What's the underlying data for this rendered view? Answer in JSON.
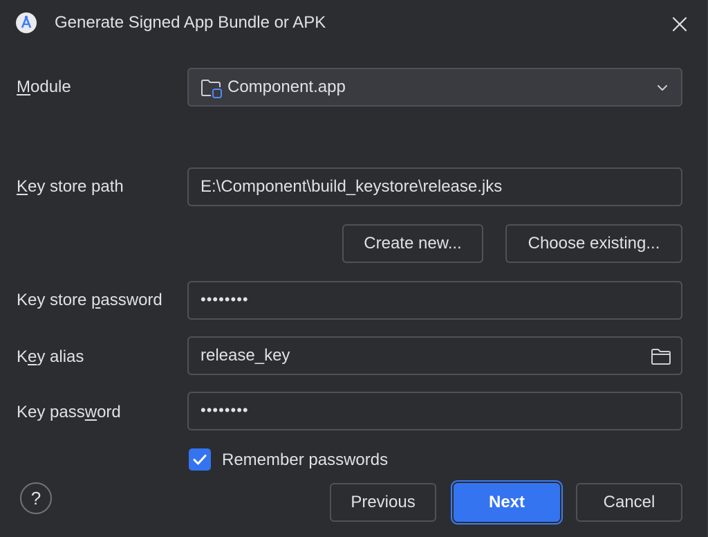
{
  "dialog": {
    "title": "Generate Signed App Bundle or APK",
    "app_icon": "android-studio-icon",
    "close_icon": "close-icon"
  },
  "module": {
    "label_mnemonic": "M",
    "label_rest": "odule",
    "selected": "Component.app",
    "icon": "module-folder-icon",
    "dropdown_icon": "chevron-down-icon"
  },
  "key_store_path": {
    "label_mnemonic": "K",
    "label_rest": "ey store path",
    "value": "E:\\Component\\build_keystore\\release.jks"
  },
  "key_store_buttons": {
    "create_new": "Create new...",
    "choose_existing": "Choose existing..."
  },
  "key_store_password": {
    "label_pre": "Key store ",
    "label_mnemonic": "p",
    "label_rest": "assword",
    "value": "••••••••"
  },
  "key_alias": {
    "label_pre": "K",
    "label_mnemonic": "e",
    "label_rest": "y alias",
    "value": "release_key",
    "browse_icon": "folder-icon"
  },
  "key_password": {
    "label_pre": "Key pass",
    "label_mnemonic": "w",
    "label_rest": "ord",
    "value": "••••••••"
  },
  "remember": {
    "label": "Remember passwords",
    "checked": true
  },
  "footer": {
    "help": "?",
    "previous": "Previous",
    "next": "Next",
    "cancel": "Cancel"
  },
  "colors": {
    "background": "#2b2d30",
    "accent": "#3574f0",
    "border": "#4e5157",
    "text": "#dfe1e5"
  }
}
